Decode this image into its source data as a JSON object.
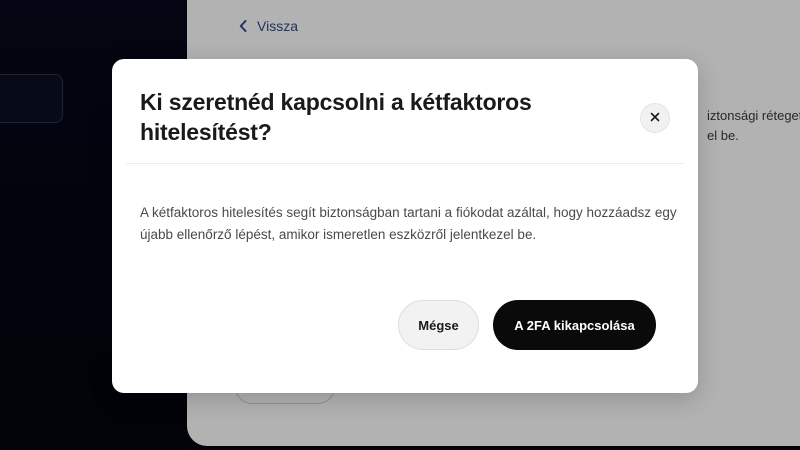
{
  "nav": {
    "back_label": "Vissza"
  },
  "background": {
    "text_line1": "iztonsági réteget",
    "text_line2": "el be."
  },
  "modal": {
    "title": "Ki szeretnéd kapcsolni a kétfaktoros hitelesítést?",
    "close_icon": "close-icon",
    "body": "A kétfaktoros hitelesítés segít biztonságban tartani a fiókodat azáltal, hogy hozzáadsz egy újabb ellenőrző lépést, amikor ismeretlen eszközről jelentkezel be.",
    "cancel_label": "Mégse",
    "confirm_label": "A 2FA kikapcsolása"
  },
  "colors": {
    "sidebar_bg": "#05081a",
    "link": "#2d4a86",
    "primary_button": "#0a0a0a"
  }
}
